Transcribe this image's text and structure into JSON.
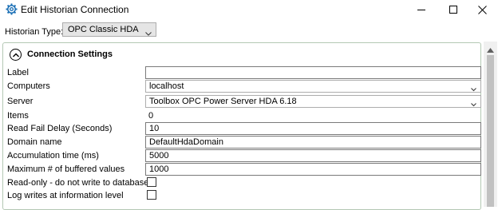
{
  "window": {
    "title": "Edit Historian Connection",
    "icon": "gear-icon",
    "controls": [
      "minimize-icon",
      "maximize-icon",
      "close-icon"
    ]
  },
  "historian_type": {
    "label": "Historian Type:",
    "selected": "OPC Classic HDA"
  },
  "section": {
    "title": "Connection Settings",
    "expanded": true
  },
  "fields": {
    "label": {
      "label": "Label",
      "value": ""
    },
    "computers": {
      "label": "Computers",
      "value": "localhost"
    },
    "server": {
      "label": "Server",
      "value": "Toolbox OPC Power Server HDA 6.18"
    },
    "items": {
      "label": "Items",
      "value": "0"
    },
    "read_fail_delay": {
      "label": "Read Fail Delay (Seconds)",
      "value": "10"
    },
    "domain_name": {
      "label": "Domain name",
      "value": "DefaultHdaDomain"
    },
    "accumulation_time": {
      "label": "Accumulation time (ms)",
      "value": "5000"
    },
    "max_buffered": {
      "label": "Maximum # of buffered values",
      "value": "1000"
    },
    "read_only": {
      "label": "Read-only - do not write to database",
      "checked": false
    },
    "log_writes": {
      "label": "Log writes at information level",
      "checked": false
    }
  },
  "colors": {
    "panel_border": "#b4c8b4",
    "scrollbar_track": "#f0f0f0",
    "scrollbar_thumb": "#c1c1c1"
  }
}
